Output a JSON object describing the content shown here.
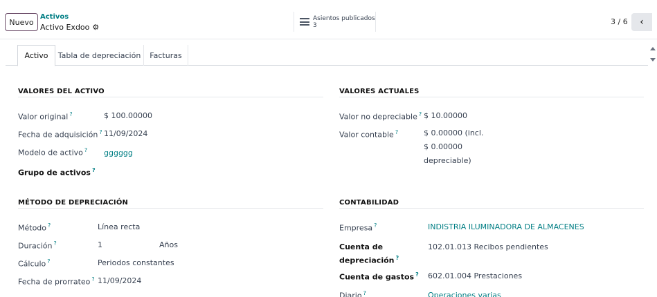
{
  "header": {
    "new_button": "Nuevo",
    "breadcrumb_parent": "Activos",
    "breadcrumb_current": "Activo Exdoo",
    "smart_button": {
      "label": "Asientos publicados",
      "count": "3"
    },
    "pager": "3 / 6"
  },
  "tabs": [
    "Activo",
    "Tabla de depreciación",
    "Facturas"
  ],
  "asset_values": {
    "title": "VALORES DEL ACTIVO",
    "original_label": "Valor original",
    "original_value": "$ 100.00000",
    "acquisition_label": "Fecha de adquisición",
    "acquisition_value": "11/09/2024",
    "model_label": "Modelo de activo",
    "model_value": "gggggg",
    "group_label": "Grupo de activos"
  },
  "current_values": {
    "title": "VALORES ACTUALES",
    "non_depreciable_label": "Valor no depreciable",
    "non_depreciable_value": "$ 10.00000",
    "book_label": "Valor contable",
    "book_line1": "$ 0.00000 (incl.",
    "book_line2": "$ 0.00000",
    "book_line3": "depreciable)"
  },
  "depreciation_method": {
    "title": "MÉTODO DE DEPRECIACIÓN",
    "method_label": "Método",
    "method_value": "Línea recta",
    "duration_label": "Duración",
    "duration_value": "1",
    "duration_unit": "Años",
    "computation_label": "Cálculo",
    "computation_value": "Periodos constantes",
    "prorata_label": "Fecha de prorrateo",
    "prorata_value": "11/09/2024"
  },
  "accounting": {
    "title": "CONTABILIDAD",
    "company_label": "Empresa",
    "company_value": "INDISTRIA ILUMINADORA DE ALMACENES",
    "dep_account_label_1": "Cuenta de",
    "dep_account_label_2": "depreciación",
    "dep_account_value": "102.01.013 Recibos pendientes",
    "expense_account_label": "Cuenta de gastos",
    "expense_account_value": "602.01.004 Prestaciones",
    "journal_label": "Diario",
    "journal_value": "Operaciones varias"
  },
  "help_mark": "?"
}
